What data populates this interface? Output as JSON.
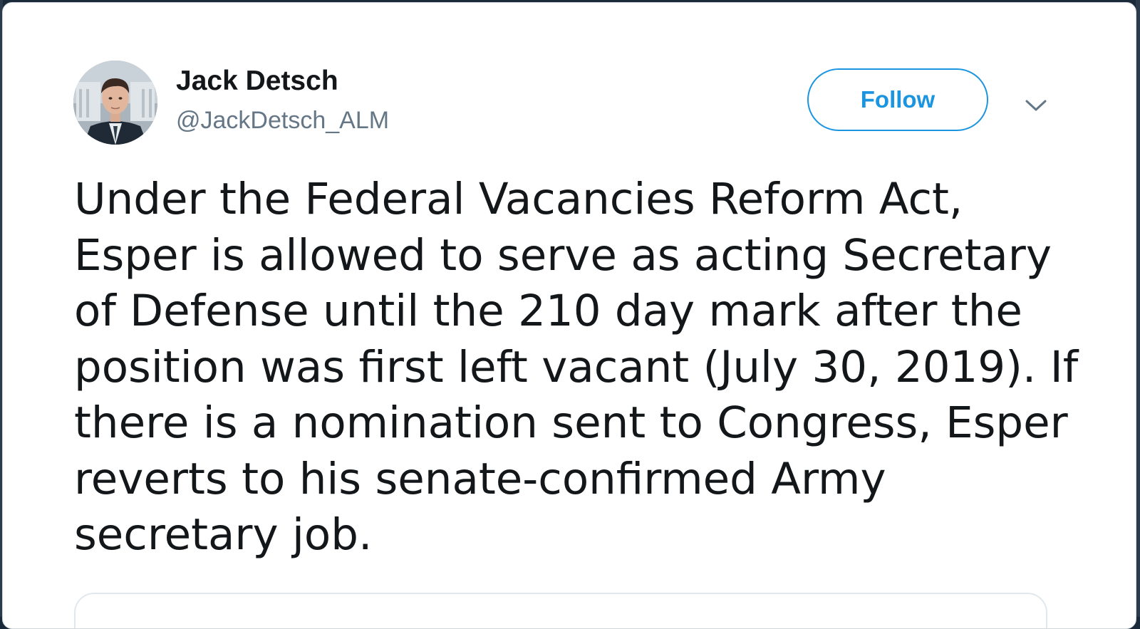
{
  "tweet": {
    "author": {
      "name": "Jack Detsch",
      "handle": "@JackDetsch_ALM",
      "avatar_icon": "profile-photo"
    },
    "follow_label": "Follow",
    "menu_icon": "chevron-down-icon",
    "text_lines": [
      "Under the Federal Vacancies Reform Act,",
      "Esper is allowed to serve as acting Secretary",
      "of Defense until the 210 day mark after the",
      "position was first left vacant (July 30, 2019). If",
      "there is a nomination sent to Congress, Esper",
      "reverts to his senate-confirmed Army",
      "secretary job."
    ]
  },
  "colors": {
    "accent": "#1b95e0",
    "text": "#14171a",
    "secondary_text": "#657786",
    "border": "#e1e8ed"
  }
}
